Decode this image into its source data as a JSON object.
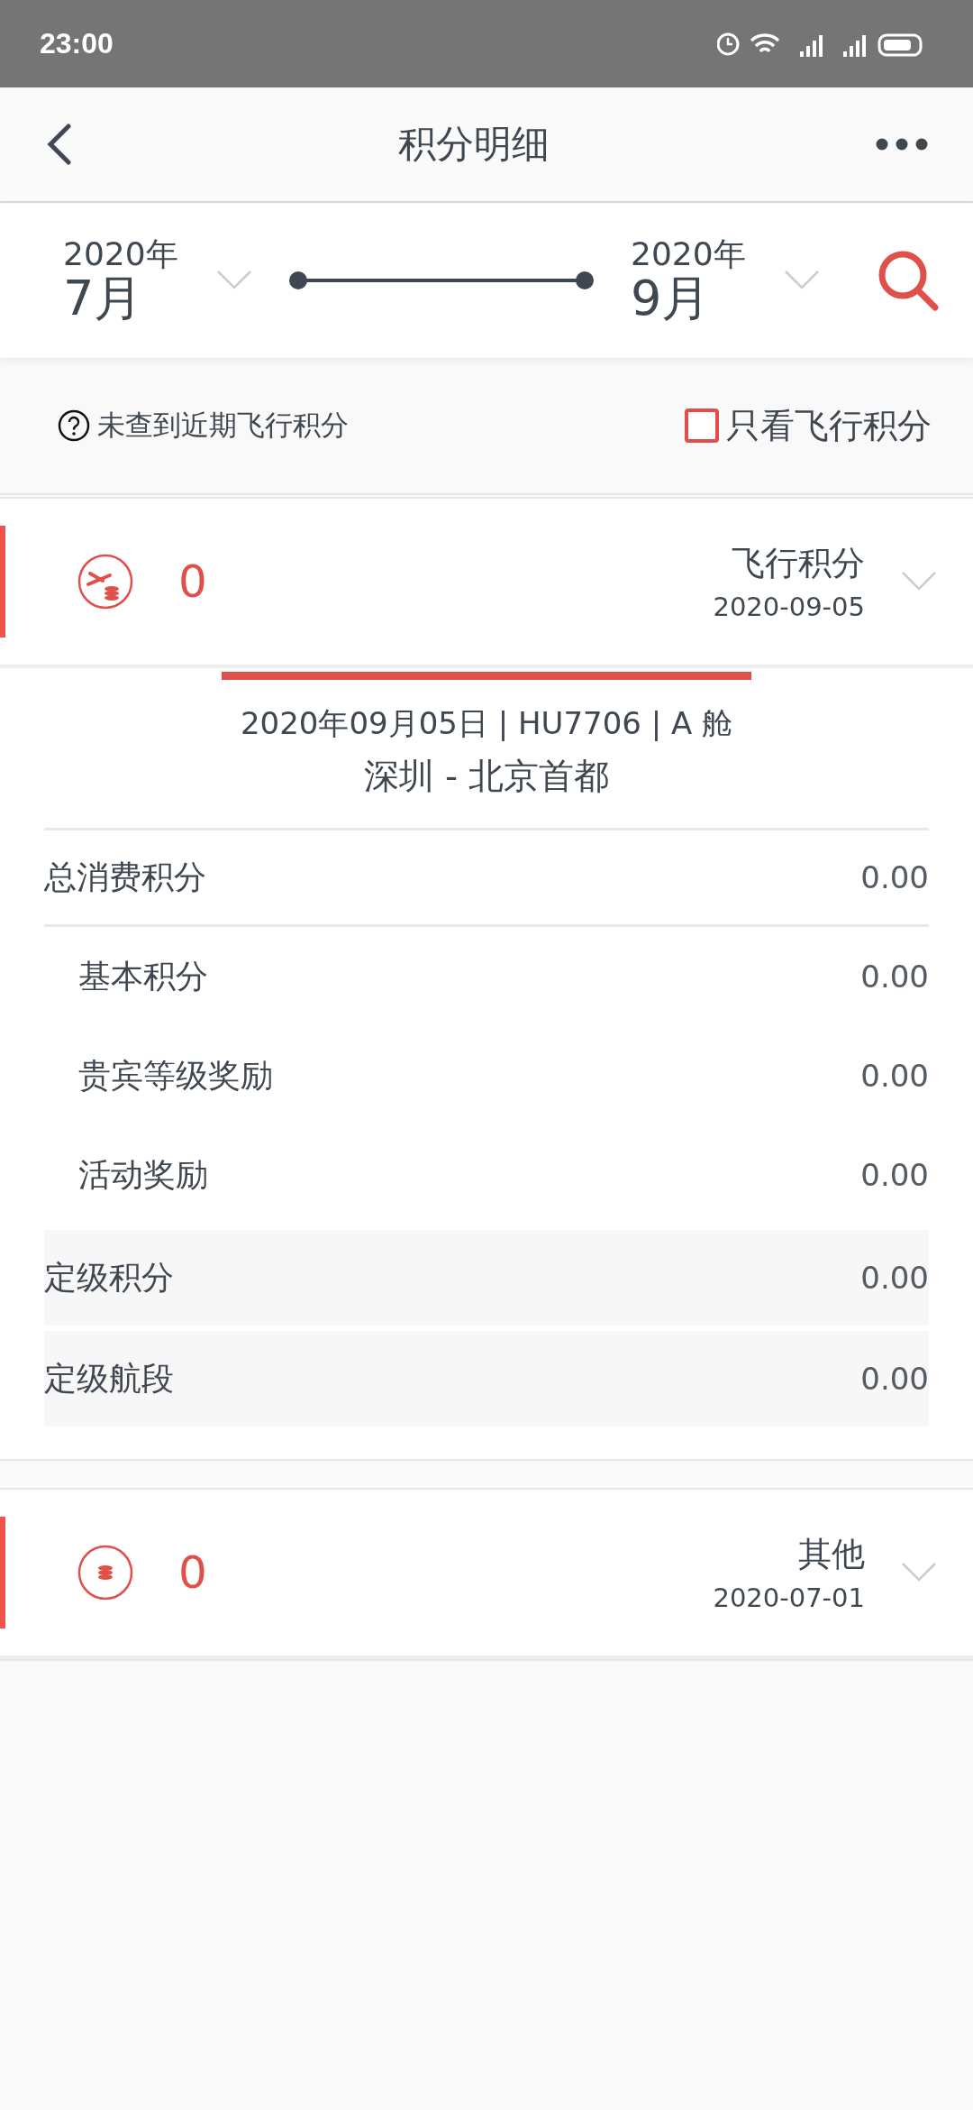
{
  "status_bar": {
    "time": "23:00"
  },
  "header": {
    "title": "积分明细"
  },
  "date_range": {
    "start": {
      "year": "2020年",
      "month": "7月"
    },
    "end": {
      "year": "2020年",
      "month": "9月"
    }
  },
  "filter": {
    "notice": "未查到近期飞行积分",
    "checkbox": {
      "label": "只看飞行积分",
      "checked": false
    }
  },
  "records": [
    {
      "kind": "flight",
      "value": "0",
      "type": "飞行积分",
      "date": "2020-09-05",
      "expanded": true,
      "detail": {
        "heading": "2020年09月05日 | HU7706 | A 舱",
        "route": "深圳 - 北京首都",
        "rows": [
          {
            "kind": "total",
            "label": "总消费积分",
            "value": "0.00"
          },
          {
            "kind": "sub",
            "label": "基本积分",
            "value": "0.00"
          },
          {
            "kind": "sub",
            "label": "贵宾等级奖励",
            "value": "0.00"
          },
          {
            "kind": "sub",
            "label": "活动奖励",
            "value": "0.00"
          },
          {
            "kind": "grade",
            "label": "定级积分",
            "value": "0.00"
          },
          {
            "kind": "grade",
            "label": "定级航段",
            "value": "0.00"
          }
        ]
      }
    },
    {
      "kind": "other",
      "value": "0",
      "type": "其他",
      "date": "2020-07-01",
      "expanded": false
    }
  ]
}
